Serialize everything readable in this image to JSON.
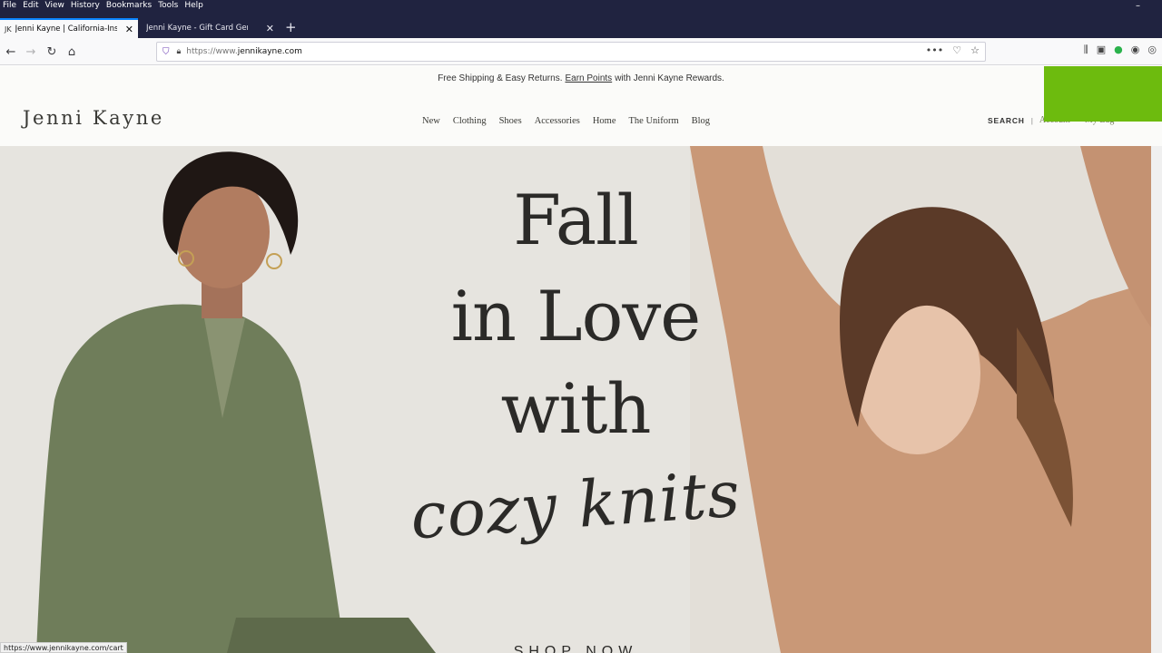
{
  "browser": {
    "menu": [
      "File",
      "Edit",
      "View",
      "History",
      "Bookmarks",
      "Tools",
      "Help"
    ],
    "window_control": "–",
    "tabs": [
      {
        "title": "Jenni Kayne | California-Inspired",
        "active": true
      },
      {
        "title": "Jenni Kayne - Gift Card Generator",
        "active": false
      }
    ],
    "new_tab": "+",
    "url_prefix": "https://www.",
    "url_host": "jennikayne.com",
    "status_url": "https://www.jennikayne.com/cart",
    "accent": "#0a84ff",
    "chrome_bg": "#202340"
  },
  "site": {
    "promo": {
      "before": "Free Shipping & Easy Returns.",
      "link": "Earn Points",
      "after": "with Jenni Kayne Rewards."
    },
    "logo": "Jenni Kayne",
    "nav": [
      "New",
      "Clothing",
      "Shoes",
      "Accessories",
      "Home",
      "The Uniform",
      "Blog"
    ],
    "utility": {
      "search": "SEARCH",
      "separator": "|",
      "account": "Account",
      "bag": "My Bag"
    },
    "hero": {
      "line1": "Fall",
      "line2": "in Love",
      "line3": "with",
      "line4": "cozy knits",
      "cta": "SHOP NOW"
    },
    "overlay_color": "#6dbb0e"
  }
}
